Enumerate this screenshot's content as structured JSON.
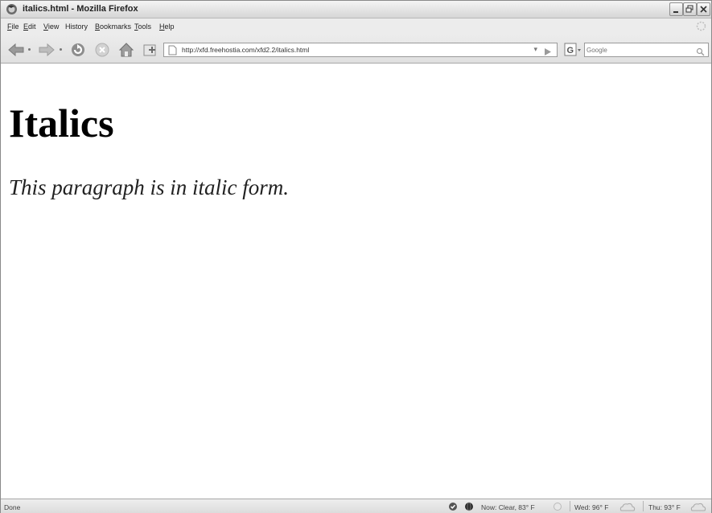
{
  "window": {
    "title": "italics.html - Mozilla Firefox"
  },
  "menu": {
    "items": [
      {
        "accel": "F",
        "rest": "ile"
      },
      {
        "accel": "E",
        "rest": "dit"
      },
      {
        "accel": "V",
        "rest": "iew"
      },
      {
        "accel": "",
        "rest": "History"
      },
      {
        "accel": "B",
        "rest": "ookmarks"
      },
      {
        "accel": "T",
        "rest": "ools"
      },
      {
        "accel": "H",
        "rest": "elp"
      }
    ]
  },
  "navbar": {
    "url": "http://xfd.freehostia.com/xfd2.2/italics.html",
    "search_placeholder": "Google"
  },
  "page": {
    "heading": "Italics",
    "paragraph": "This paragraph is in italic form."
  },
  "statusbar": {
    "status": "Done",
    "weather_now": "Now: Clear, 83° F",
    "weather_wed": "Wed: 96° F",
    "weather_thu": "Thu: 93° F"
  },
  "colors": {
    "chrome": "#ececec",
    "window_border": "#8a8a8a",
    "content_bg": "#ffffff"
  },
  "icons": [
    "firefox-icon",
    "minimize-icon",
    "maximize-icon",
    "close-icon",
    "throbber-icon",
    "back-icon",
    "forward-icon",
    "reload-icon",
    "stop-icon",
    "home-icon",
    "bookmark-add-icon",
    "page-icon",
    "go-icon",
    "google-icon",
    "search-icon",
    "status-check-icon",
    "status-globe-icon",
    "weather-sun-icon",
    "weather-cloud-icon"
  ]
}
